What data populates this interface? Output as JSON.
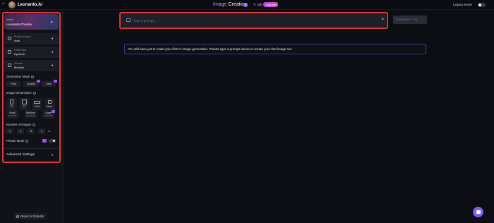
{
  "topbar": {
    "back_glyph": "<",
    "brand": "Leonardo.Ai",
    "title_part1": "Image",
    "title_part2": "Creation",
    "help_glyph": "?",
    "token_count": "✎ 150",
    "upgrade_label": "Upgrade",
    "legacy_mode_label": "Legacy Mode"
  },
  "sidebar": {
    "model": {
      "small_label": "Model",
      "name": "Leonardo Phoenix"
    },
    "selects": [
      {
        "small_label": "Prompt Enhance",
        "value": "Auto",
        "icon": "sparkle-icon"
      },
      {
        "small_label": "Preset Style",
        "value": "Dynamic",
        "icon": "palette-icon"
      },
      {
        "small_label": "Contrast",
        "value": "Medium",
        "icon": "contrast-icon"
      }
    ],
    "generation_mode": {
      "label": "Generation Mode",
      "options": [
        "Fast",
        "Quality",
        "Ultra"
      ]
    },
    "image_dimensions": {
      "label": "Image Dimensions",
      "ratios": [
        "2:3",
        "1:1",
        "16:9",
        "More"
      ],
      "sizes": [
        {
          "label": "Small",
          "sub": "832x1248"
        },
        {
          "label": "Medium",
          "sub": "1024x1536"
        },
        {
          "label": "Large",
          "sub": "1248x1856"
        }
      ]
    },
    "number_of_images": {
      "label": "Number of Images",
      "options": [
        "1",
        "2",
        "3",
        "4"
      ],
      "more_glyph": "▸"
    },
    "private_mode": {
      "label": "Private Mode"
    },
    "advanced_settings": "Advanced Settings",
    "reset_label": "Reset to Defaults"
  },
  "main": {
    "prompt_placeholder": "Type a prompt ...",
    "generate_label": "Generate ✎ 16",
    "notice": "You still have yet to make your first AI image generation. Please type a prompt above to create your first image set."
  },
  "colors": {
    "accent": "#9c55e6",
    "highlight": "#e2373d",
    "notice_border": "#3a3b8a"
  }
}
